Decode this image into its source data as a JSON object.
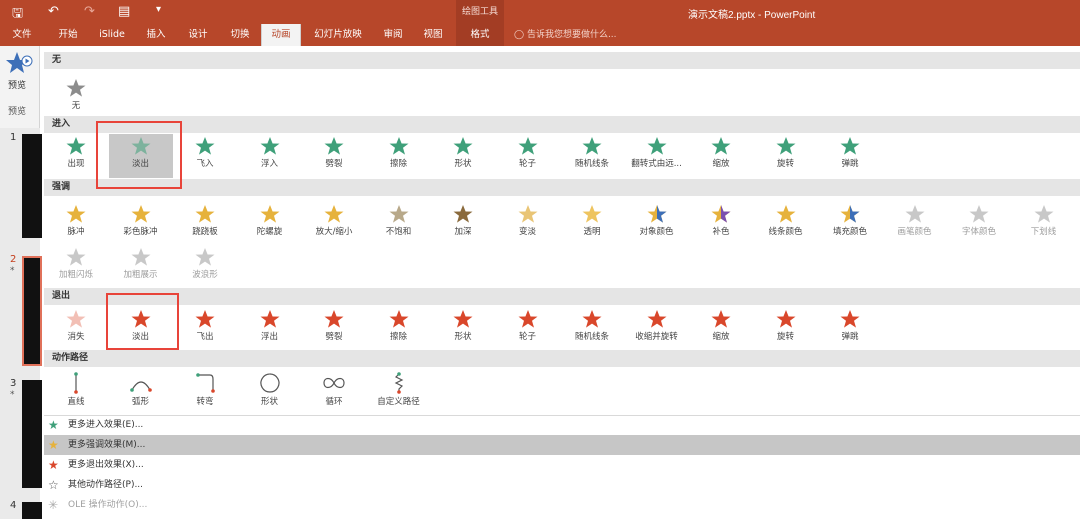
{
  "titlebar": {
    "drawing_tools": "绘图工具",
    "doc_title": "演示文稿2.pptx - PowerPoint"
  },
  "tabs": [
    {
      "label": "文件"
    },
    {
      "label": "开始"
    },
    {
      "label": "iSlide"
    },
    {
      "label": "插入"
    },
    {
      "label": "设计"
    },
    {
      "label": "切换"
    },
    {
      "label": "动画"
    },
    {
      "label": "幻灯片放映"
    },
    {
      "label": "审阅"
    },
    {
      "label": "视图"
    },
    {
      "label": "格式"
    }
  ],
  "tellme": "告诉我您想要做什么...",
  "left": {
    "preview_label": "预览",
    "group_label": "预览",
    "slides": [
      "1",
      "2",
      "3",
      "4"
    ]
  },
  "sections": {
    "none": "无",
    "entrance": "进入",
    "emphasis": "强调",
    "exit": "退出",
    "motion": "动作路径"
  },
  "none_items": [
    {
      "label": "无"
    }
  ],
  "entrance_items": [
    {
      "label": "出现"
    },
    {
      "label": "淡出"
    },
    {
      "label": "飞入"
    },
    {
      "label": "浮入"
    },
    {
      "label": "劈裂"
    },
    {
      "label": "擦除"
    },
    {
      "label": "形状"
    },
    {
      "label": "轮子"
    },
    {
      "label": "随机线条"
    },
    {
      "label": "翻转式由远..."
    },
    {
      "label": "缩放"
    },
    {
      "label": "旋转"
    },
    {
      "label": "弹跳"
    }
  ],
  "emphasis_items": [
    {
      "label": "脉冲"
    },
    {
      "label": "彩色脉冲"
    },
    {
      "label": "跷跷板"
    },
    {
      "label": "陀螺旋"
    },
    {
      "label": "放大/缩小"
    },
    {
      "label": "不饱和"
    },
    {
      "label": "加深"
    },
    {
      "label": "变淡"
    },
    {
      "label": "透明"
    },
    {
      "label": "对象颜色"
    },
    {
      "label": "补色"
    },
    {
      "label": "线条颜色"
    },
    {
      "label": "填充颜色"
    },
    {
      "label": "画笔颜色"
    },
    {
      "label": "字体颜色"
    },
    {
      "label": "下划线"
    },
    {
      "label": "加粗闪烁"
    },
    {
      "label": "加粗展示"
    },
    {
      "label": "波浪形"
    }
  ],
  "exit_items": [
    {
      "label": "消失"
    },
    {
      "label": "淡出"
    },
    {
      "label": "飞出"
    },
    {
      "label": "浮出"
    },
    {
      "label": "劈裂"
    },
    {
      "label": "擦除"
    },
    {
      "label": "形状"
    },
    {
      "label": "轮子"
    },
    {
      "label": "随机线条"
    },
    {
      "label": "收缩并旋转"
    },
    {
      "label": "缩放"
    },
    {
      "label": "旋转"
    },
    {
      "label": "弹跳"
    }
  ],
  "motion_items": [
    {
      "label": "直线"
    },
    {
      "label": "弧形"
    },
    {
      "label": "转弯"
    },
    {
      "label": "形状"
    },
    {
      "label": "循环"
    },
    {
      "label": "自定义路径"
    }
  ],
  "menu": [
    {
      "label": "更多进入效果(E)..."
    },
    {
      "label": "更多强调效果(M)..."
    },
    {
      "label": "更多退出效果(X)..."
    },
    {
      "label": "其他动作路径(P)..."
    },
    {
      "label": "OLE 操作动作(O)..."
    }
  ],
  "colors": {
    "accent": "#b7472a",
    "entrance_star": "#3fa07a",
    "emphasis_star": "#e6b23c",
    "exit_star": "#d9472b",
    "highlight_box": "#e8443a"
  }
}
